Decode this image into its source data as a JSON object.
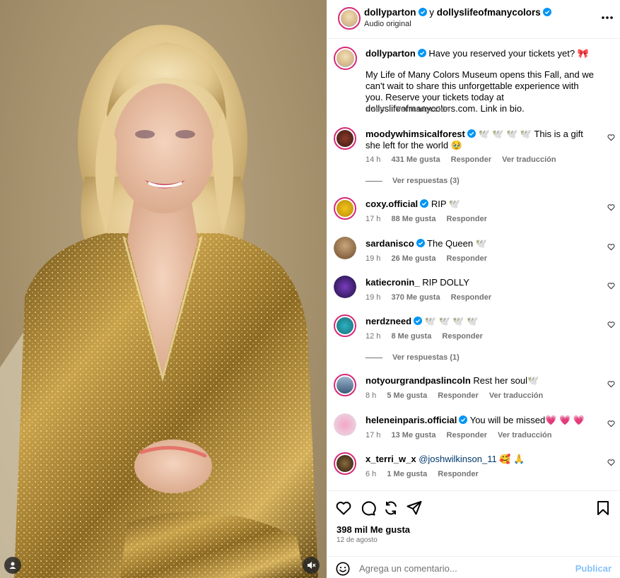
{
  "header": {
    "author": "dollyparton",
    "connector": "y",
    "collaborator": "dollyslifeofmanycolors",
    "audio": "Audio original",
    "more_icon": "more-icon"
  },
  "caption": {
    "username": "dollyparton",
    "headline": "Have you reserved your tickets yet? 🎀",
    "body": "My Life of Many Colors Museum opens this Fall, and we can't wait to share this unforgettable experience with you. Reserve your tickets today at dollyslifeofmanycolors.com. Link in bio.",
    "time": "1 sem",
    "translate": "Ver traducción"
  },
  "comments": [
    {
      "user": "moodywhimsicalforest",
      "verified": true,
      "text": "🕊️ 🕊️ 🕊️ 🕊️  This is a gift she left for the world 🥹",
      "time": "14 h",
      "likes": "431 Me gusta",
      "reply": "Responder",
      "translate": "Ver traducción",
      "replies": "Ver respuestas (3)"
    },
    {
      "user": "coxy.official",
      "verified": true,
      "text": "RIP 🕊️",
      "time": "17 h",
      "likes": "88 Me gusta",
      "reply": "Responder"
    },
    {
      "user": "sardanisco",
      "verified": true,
      "text": "The Queen 🕊️",
      "time": "19 h",
      "likes": "26 Me gusta",
      "reply": "Responder"
    },
    {
      "user": "katiecronin_",
      "verified": false,
      "text": "RIP DOLLY",
      "time": "19 h",
      "likes": "370 Me gusta",
      "reply": "Responder"
    },
    {
      "user": "nerdzneed",
      "verified": true,
      "text": "🕊️ 🕊️ 🕊️ 🕊️",
      "time": "12 h",
      "likes": "8 Me gusta",
      "reply": "Responder",
      "replies": "Ver respuestas (1)"
    },
    {
      "user": "notyourgrandpaslincoln",
      "verified": false,
      "text": "Rest her soul🕊️",
      "time": "8 h",
      "likes": "5 Me gusta",
      "reply": "Responder",
      "translate": "Ver traducción"
    },
    {
      "user": "heleneinparis.official",
      "verified": true,
      "text": "You will be missed💗 💗 💗",
      "time": "17 h",
      "likes": "13 Me gusta",
      "reply": "Responder",
      "translate": "Ver traducción"
    },
    {
      "user": "x_terri_w_x",
      "verified": false,
      "mention": "@joshwilkinson_11",
      "text": "🥰 🙏",
      "time": "6 h",
      "likes": "1 Me gusta",
      "reply": "Responder"
    }
  ],
  "footer": {
    "likes": "398 mil Me gusta",
    "date": "12 de agosto",
    "comment_placeholder": "Agrega un comentario...",
    "publish": "Publicar"
  },
  "colors": {
    "verified": "#0095f6",
    "story_ring": "#d62976",
    "publish": "#85c1f9",
    "gold_dress": "#b08a2e",
    "background_photo": "#a8946f"
  },
  "icons": [
    "heart-icon",
    "comment-icon",
    "share-icon",
    "send-icon",
    "save-icon",
    "emoji-icon",
    "tag-icon",
    "mute-icon",
    "verified-icon"
  ]
}
